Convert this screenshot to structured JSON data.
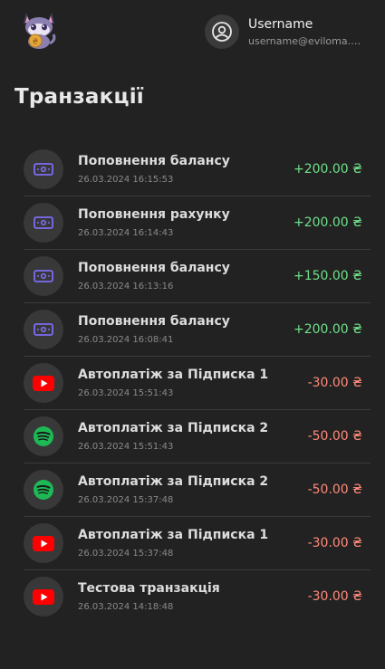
{
  "header": {
    "logo_icon": "cat-mascot-with-coin-icon",
    "user_icon": "user-circle-icon",
    "username": "Username",
    "email": "username@eviloma.org"
  },
  "page": {
    "title": "Транзакції"
  },
  "colors": {
    "background": "#222222",
    "positive_amount": "#6fe08a",
    "negative_amount": "#ff8a7a",
    "topup_icon": "#7b6cf0",
    "youtube": "#ff0000",
    "spotify": "#1db954"
  },
  "transactions": [
    {
      "icon": "money-bill-icon",
      "title": "Поповнення балансу",
      "date": "26.03.2024 16:15:53",
      "amount": "+200.00 ₴",
      "type": "positive"
    },
    {
      "icon": "money-bill-icon",
      "title": "Поповнення рахунку",
      "date": "26.03.2024 16:14:43",
      "amount": "+200.00 ₴",
      "type": "positive"
    },
    {
      "icon": "money-bill-icon",
      "title": "Поповнення балансу",
      "date": "26.03.2024 16:13:16",
      "amount": "+150.00 ₴",
      "type": "positive"
    },
    {
      "icon": "money-bill-icon",
      "title": "Поповнення балансу",
      "date": "26.03.2024 16:08:41",
      "amount": "+200.00 ₴",
      "type": "positive"
    },
    {
      "icon": "youtube-icon",
      "title": "Автоплатіж за Підписка 1",
      "date": "26.03.2024 15:51:43",
      "amount": "-30.00 ₴",
      "type": "negative"
    },
    {
      "icon": "spotify-icon",
      "title": "Автоплатіж за Підписка 2",
      "date": "26.03.2024 15:51:43",
      "amount": "-50.00 ₴",
      "type": "negative"
    },
    {
      "icon": "spotify-icon",
      "title": "Автоплатіж за Підписка 2",
      "date": "26.03.2024 15:37:48",
      "amount": "-50.00 ₴",
      "type": "negative"
    },
    {
      "icon": "youtube-icon",
      "title": "Автоплатіж за Підписка 1",
      "date": "26.03.2024 15:37:48",
      "amount": "-30.00 ₴",
      "type": "negative"
    },
    {
      "icon": "youtube-icon",
      "title": "Тестова транзакція",
      "date": "26.03.2024 14:18:48",
      "amount": "-30.00 ₴",
      "type": "negative"
    }
  ]
}
